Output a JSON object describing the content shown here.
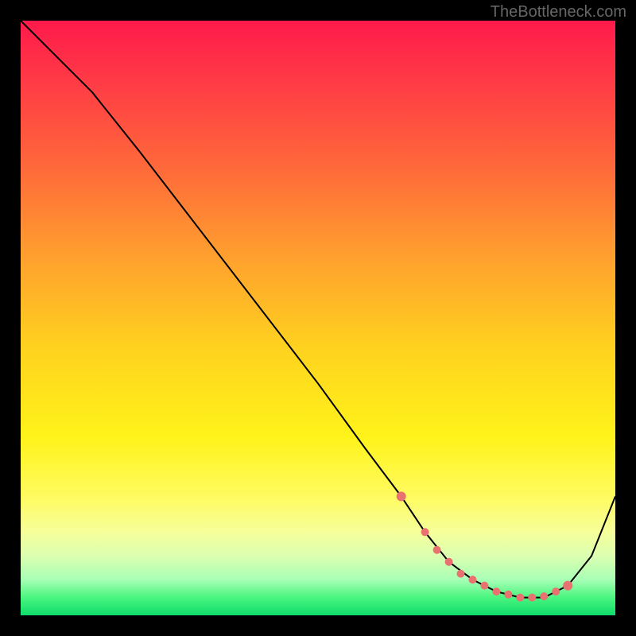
{
  "watermark": "TheBottleneck.com",
  "chart_data": {
    "type": "line",
    "title": "",
    "xlabel": "",
    "ylabel": "",
    "xlim": [
      0,
      100
    ],
    "ylim": [
      0,
      100
    ],
    "series": [
      {
        "name": "curve",
        "x": [
          0,
          6,
          12,
          20,
          30,
          40,
          50,
          58,
          64,
          68,
          72,
          76,
          80,
          84,
          88,
          92,
          96,
          100
        ],
        "y": [
          100,
          94,
          88,
          78,
          65,
          52,
          39,
          28,
          20,
          14,
          9,
          6,
          4,
          3,
          3,
          5,
          10,
          20
        ]
      }
    ],
    "marker_points": {
      "name": "dots",
      "x": [
        64,
        68,
        70,
        72,
        74,
        76,
        78,
        80,
        82,
        84,
        86,
        88,
        90,
        92
      ],
      "y": [
        20,
        14,
        11,
        9,
        7,
        6,
        5,
        4,
        3.5,
        3,
        3,
        3.2,
        4,
        5
      ]
    },
    "gradient_note": "Background vertical gradient red→yellow→green indicates bottleneck severity; curve min near x≈84"
  }
}
